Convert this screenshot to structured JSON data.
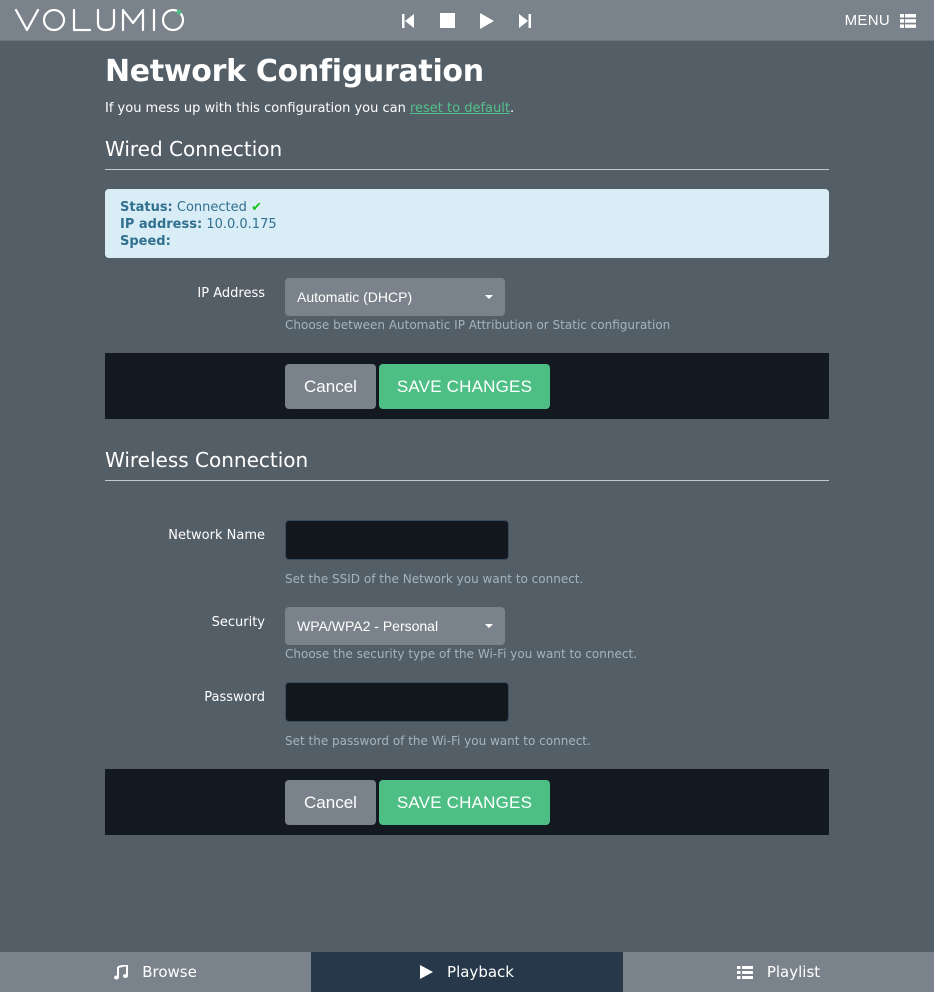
{
  "header": {
    "logo_text": "VOLUMIO",
    "menu_label": "MENU"
  },
  "page": {
    "title": "Network Configuration",
    "intro_prefix": "If you mess up with this configuration you can ",
    "intro_link": "reset to default",
    "intro_suffix": "."
  },
  "wired": {
    "section_title": "Wired Connection",
    "status_label": "Status:",
    "status_value": "Connected",
    "ip_label": "IP address:",
    "ip_value": "10.0.0.175",
    "speed_label": "Speed:",
    "speed_value": "",
    "ip_address_label": "IP Address",
    "ip_mode_value": "Automatic (DHCP)",
    "ip_mode_help": "Choose between Automatic IP Attribution or Static configuration",
    "cancel_label": "Cancel",
    "save_label": "SAVE CHANGES"
  },
  "wireless": {
    "section_title": "Wireless Connection",
    "network_name_label": "Network Name",
    "network_name_value": "",
    "network_name_help": "Set the SSID of the Network you want to connect.",
    "security_label": "Security",
    "security_value": "WPA/WPA2 - Personal",
    "security_help": "Choose the security type of the Wi-Fi you want to connect.",
    "password_label": "Password",
    "password_value": "",
    "password_help": "Set the password of the Wi-Fi you want to connect.",
    "cancel_label": "Cancel",
    "save_label": "SAVE CHANGES"
  },
  "footer": {
    "browse_label": "Browse",
    "playback_label": "Playback",
    "playlist_label": "Playlist"
  },
  "colors": {
    "background": "#545e67",
    "bar": "#7a838b",
    "accent_green": "#4dbf85",
    "active_tab": "#263849",
    "info_box": "#d9edf7"
  }
}
